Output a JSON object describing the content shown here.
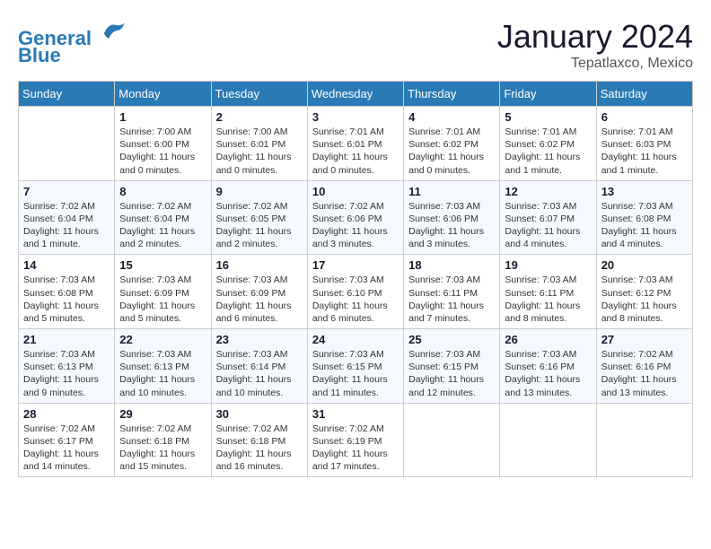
{
  "header": {
    "logo_line1": "General",
    "logo_line2": "Blue",
    "month": "January 2024",
    "location": "Tepatlaxco, Mexico"
  },
  "days_of_week": [
    "Sunday",
    "Monday",
    "Tuesday",
    "Wednesday",
    "Thursday",
    "Friday",
    "Saturday"
  ],
  "weeks": [
    [
      {
        "day": null
      },
      {
        "day": "1",
        "sunrise": "7:00 AM",
        "sunset": "6:00 PM",
        "daylight": "11 hours and 0 minutes."
      },
      {
        "day": "2",
        "sunrise": "7:00 AM",
        "sunset": "6:01 PM",
        "daylight": "11 hours and 0 minutes."
      },
      {
        "day": "3",
        "sunrise": "7:01 AM",
        "sunset": "6:01 PM",
        "daylight": "11 hours and 0 minutes."
      },
      {
        "day": "4",
        "sunrise": "7:01 AM",
        "sunset": "6:02 PM",
        "daylight": "11 hours and 0 minutes."
      },
      {
        "day": "5",
        "sunrise": "7:01 AM",
        "sunset": "6:02 PM",
        "daylight": "11 hours and 1 minute."
      },
      {
        "day": "6",
        "sunrise": "7:01 AM",
        "sunset": "6:03 PM",
        "daylight": "11 hours and 1 minute."
      }
    ],
    [
      {
        "day": "7",
        "sunrise": "7:02 AM",
        "sunset": "6:04 PM",
        "daylight": "11 hours and 1 minute."
      },
      {
        "day": "8",
        "sunrise": "7:02 AM",
        "sunset": "6:04 PM",
        "daylight": "11 hours and 2 minutes."
      },
      {
        "day": "9",
        "sunrise": "7:02 AM",
        "sunset": "6:05 PM",
        "daylight": "11 hours and 2 minutes."
      },
      {
        "day": "10",
        "sunrise": "7:02 AM",
        "sunset": "6:06 PM",
        "daylight": "11 hours and 3 minutes."
      },
      {
        "day": "11",
        "sunrise": "7:03 AM",
        "sunset": "6:06 PM",
        "daylight": "11 hours and 3 minutes."
      },
      {
        "day": "12",
        "sunrise": "7:03 AM",
        "sunset": "6:07 PM",
        "daylight": "11 hours and 4 minutes."
      },
      {
        "day": "13",
        "sunrise": "7:03 AM",
        "sunset": "6:08 PM",
        "daylight": "11 hours and 4 minutes."
      }
    ],
    [
      {
        "day": "14",
        "sunrise": "7:03 AM",
        "sunset": "6:08 PM",
        "daylight": "11 hours and 5 minutes."
      },
      {
        "day": "15",
        "sunrise": "7:03 AM",
        "sunset": "6:09 PM",
        "daylight": "11 hours and 5 minutes."
      },
      {
        "day": "16",
        "sunrise": "7:03 AM",
        "sunset": "6:09 PM",
        "daylight": "11 hours and 6 minutes."
      },
      {
        "day": "17",
        "sunrise": "7:03 AM",
        "sunset": "6:10 PM",
        "daylight": "11 hours and 6 minutes."
      },
      {
        "day": "18",
        "sunrise": "7:03 AM",
        "sunset": "6:11 PM",
        "daylight": "11 hours and 7 minutes."
      },
      {
        "day": "19",
        "sunrise": "7:03 AM",
        "sunset": "6:11 PM",
        "daylight": "11 hours and 8 minutes."
      },
      {
        "day": "20",
        "sunrise": "7:03 AM",
        "sunset": "6:12 PM",
        "daylight": "11 hours and 8 minutes."
      }
    ],
    [
      {
        "day": "21",
        "sunrise": "7:03 AM",
        "sunset": "6:13 PM",
        "daylight": "11 hours and 9 minutes."
      },
      {
        "day": "22",
        "sunrise": "7:03 AM",
        "sunset": "6:13 PM",
        "daylight": "11 hours and 10 minutes."
      },
      {
        "day": "23",
        "sunrise": "7:03 AM",
        "sunset": "6:14 PM",
        "daylight": "11 hours and 10 minutes."
      },
      {
        "day": "24",
        "sunrise": "7:03 AM",
        "sunset": "6:15 PM",
        "daylight": "11 hours and 11 minutes."
      },
      {
        "day": "25",
        "sunrise": "7:03 AM",
        "sunset": "6:15 PM",
        "daylight": "11 hours and 12 minutes."
      },
      {
        "day": "26",
        "sunrise": "7:03 AM",
        "sunset": "6:16 PM",
        "daylight": "11 hours and 13 minutes."
      },
      {
        "day": "27",
        "sunrise": "7:02 AM",
        "sunset": "6:16 PM",
        "daylight": "11 hours and 13 minutes."
      }
    ],
    [
      {
        "day": "28",
        "sunrise": "7:02 AM",
        "sunset": "6:17 PM",
        "daylight": "11 hours and 14 minutes."
      },
      {
        "day": "29",
        "sunrise": "7:02 AM",
        "sunset": "6:18 PM",
        "daylight": "11 hours and 15 minutes."
      },
      {
        "day": "30",
        "sunrise": "7:02 AM",
        "sunset": "6:18 PM",
        "daylight": "11 hours and 16 minutes."
      },
      {
        "day": "31",
        "sunrise": "7:02 AM",
        "sunset": "6:19 PM",
        "daylight": "11 hours and 17 minutes."
      },
      {
        "day": null
      },
      {
        "day": null
      },
      {
        "day": null
      }
    ]
  ]
}
